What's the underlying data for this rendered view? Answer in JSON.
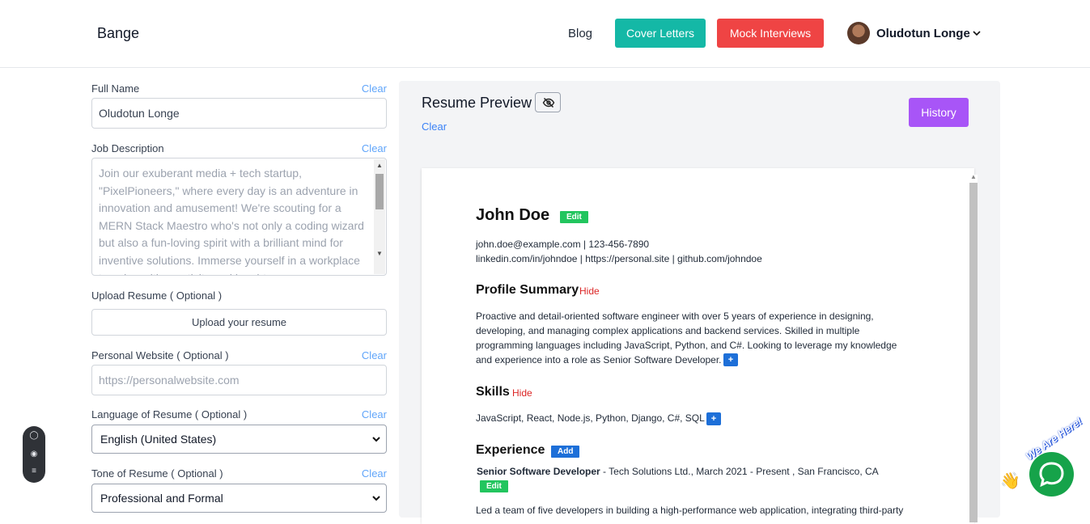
{
  "header": {
    "brand": "Bange",
    "nav_blog": "Blog",
    "cover_letters": "Cover Letters",
    "mock_interviews": "Mock Interviews",
    "user_name": "Oludotun Longe",
    "colors": {
      "cover": "#14b8a6",
      "mock": "#ef4444"
    }
  },
  "form": {
    "full_name_label": "Full Name",
    "full_name_value": "Oludotun Longe",
    "job_desc_label": "Job Description",
    "job_desc_placeholder": "Join our exuberant media + tech startup, \"PixelPioneers,\" where every day is an adventure in innovation and amusement! We're scouting for a MERN Stack Maestro who's not only a coding wizard but also a fun-loving spirit with a brilliant mind for inventive solutions. Immerse yourself in a workplace teeming with creativity and laughter,",
    "upload_label": "Upload Resume ( Optional )",
    "upload_button": "Upload your resume",
    "website_label": "Personal Website ( Optional )",
    "website_placeholder": "https://personalwebsite.com",
    "language_label": "Language of Resume ( Optional )",
    "language_value": "English (United States)",
    "tone_label": "Tone of Resume ( Optional )",
    "tone_value": "Professional and Formal",
    "clear": "Clear"
  },
  "preview": {
    "title": "Resume Preview",
    "clear": "Clear",
    "history": "History",
    "history_color": "#a855f7"
  },
  "resume": {
    "name": "John Doe",
    "edit": "Edit",
    "contact_line1": "john.doe@example.com | 123-456-7890",
    "contact_line2": "linkedin.com/in/johndoe | https://personal.site | github.com/johndoe",
    "profile_heading": "Profile Summary",
    "hide": "Hide",
    "profile_text": "Proactive and detail-oriented software engineer with over 5 years of experience in designing, developing, and managing complex applications and backend services. Skilled in multiple programming languages including JavaScript, Python, and C#. Looking to leverage my knowledge and experience into a role as Senior Software Developer.",
    "skills_heading": "Skills",
    "skills_text": "JavaScript, React, Node.js, Python, Django, C#, SQL",
    "plus": "+",
    "experience_heading": "Experience",
    "add": "Add",
    "job_title": "Senior Software Developer",
    "job_rest": " - Tech Solutions Ltd., March 2021 - Present , San Francisco, CA",
    "job_bullet": "Led a team of five developers in building a high-performance web application, integrating third-party"
  },
  "chat_widget": {
    "text": "We Are Here!",
    "color": "#16a34a"
  }
}
